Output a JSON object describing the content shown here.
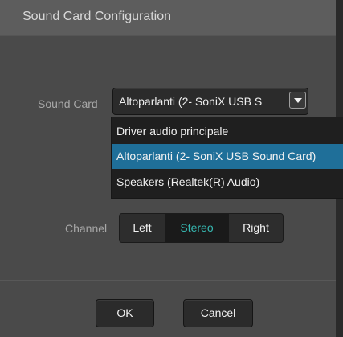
{
  "dialog": {
    "title": "Sound Card Configuration"
  },
  "sound_card": {
    "label": "Sound Card",
    "selected_value": "Altoparlanti (2- SoniX USB S",
    "options": [
      {
        "label": "Driver audio principale",
        "selected": false
      },
      {
        "label": "Altoparlanti (2- SoniX USB Sound Card)",
        "selected": true
      },
      {
        "label": "Speakers (Realtek(R) Audio)",
        "selected": false
      }
    ]
  },
  "channel": {
    "label": "Channel",
    "options": [
      {
        "label": "Left",
        "selected": false
      },
      {
        "label": "Stereo",
        "selected": true
      },
      {
        "label": "Right",
        "selected": false
      }
    ]
  },
  "buttons": {
    "ok": "OK",
    "cancel": "Cancel"
  },
  "icons": {
    "dropdown": "chevron-down-icon"
  },
  "colors": {
    "selected_option_background": "#1f6f99",
    "selected_channel_text": "#36b7b0"
  }
}
